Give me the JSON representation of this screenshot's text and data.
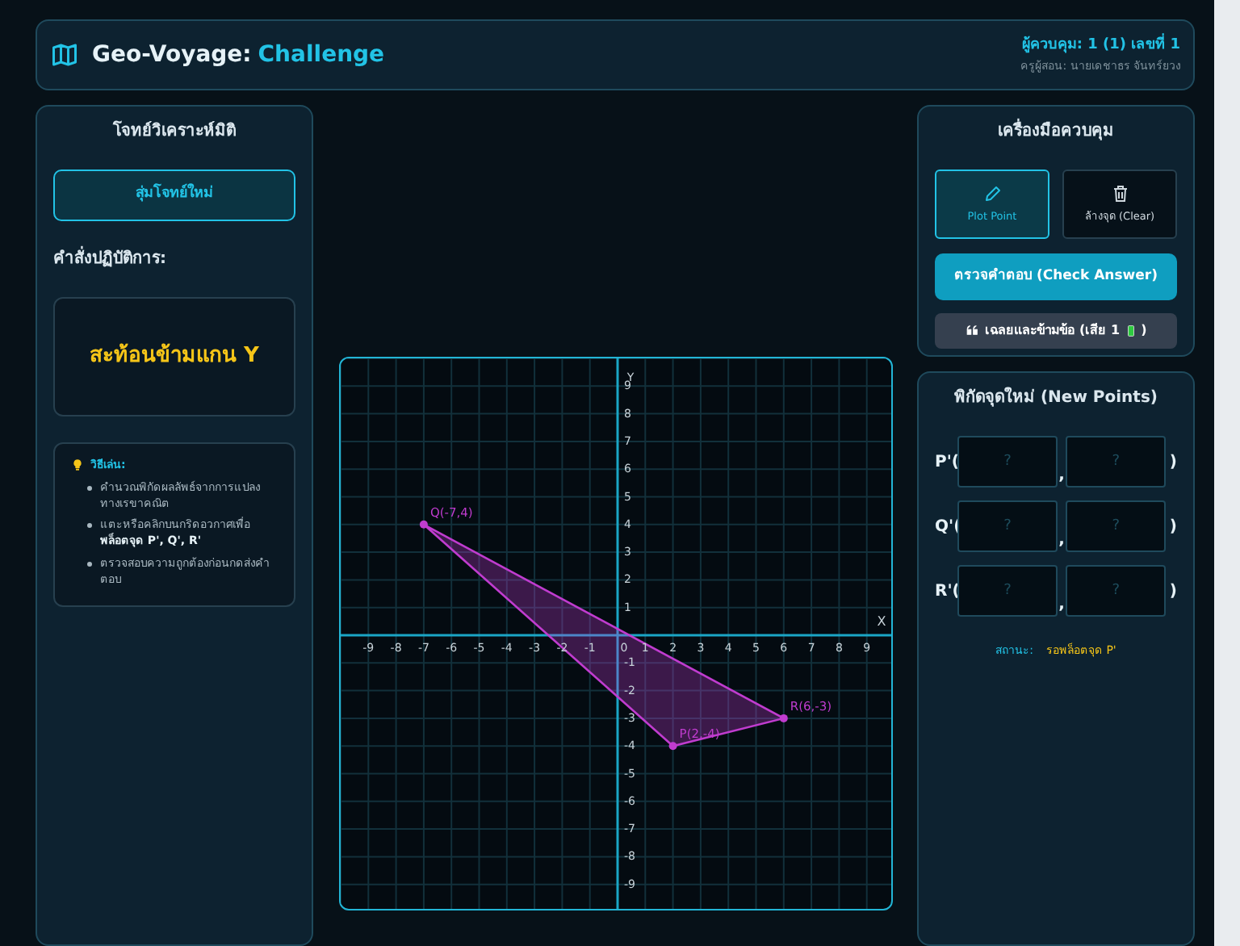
{
  "header": {
    "title": "Geo-Voyage:",
    "title_highlight": "Challenge",
    "player": "ผู้ควบคุม: 1 (1) เลขที่ 1",
    "teacher": "ครูผู้สอน: นายเดชาธร จันทร์ยวง"
  },
  "mission_panel": {
    "title": "โจทย์วิเคราะห์มิติ",
    "new_button": "สุ่มโจทย์ใหม่",
    "instruction_label": "คำสั่งปฏิบัติการ:",
    "task": "สะท้อนข้ามแกน Y",
    "tips": {
      "title": "วิธีเล่น:",
      "items": [
        "คำนวณพิกัดผลลัพธ์จากการแปลงทางเรขาคณิต",
        "แตะหรือคลิกบนกริดอวกาศเพื่อ **พล็อตจุด P', Q', R'**",
        "ตรวจสอบความถูกต้องก่อนกดส่งคำตอบ"
      ]
    }
  },
  "graph": {
    "chart_data": {
      "type": "scatter",
      "xlabel": "X",
      "ylabel": "Y",
      "grid": true,
      "xlim": [
        -10,
        10
      ],
      "ylim": [
        -10,
        10
      ],
      "xticks": [
        -9,
        -8,
        -7,
        -6,
        -5,
        -4,
        -3,
        -2,
        -1,
        0,
        1,
        2,
        3,
        4,
        5,
        6,
        7,
        8,
        9
      ],
      "yticks": [
        -9,
        -8,
        -7,
        -6,
        -5,
        -4,
        -3,
        -2,
        -1,
        1,
        2,
        3,
        4,
        5,
        6,
        7,
        8,
        9
      ],
      "x": [
        2,
        -7,
        6
      ],
      "series": [
        {
          "color": "#c03ccf",
          "values": [
            -4,
            4,
            -3
          ]
        }
      ],
      "annotations": [
        "P(2,-4)",
        "Q(-7,4)",
        "R(6,-3)"
      ]
    }
  },
  "tools_panel": {
    "title": "เครื่องมือควบคุม",
    "tools": [
      {
        "kind": "pencil",
        "label": "Plot Point",
        "selected": true
      },
      {
        "kind": "trash",
        "label": "ล้างจุด (Clear)",
        "selected": false
      }
    ],
    "check_button": "ตรวจคำตอบ (Check Answer)",
    "skip_button": {
      "text": "เฉลยและข้ามข้อ (เสีย 1",
      "close": ")"
    }
  },
  "points_panel": {
    "title": "พิกัดจุดใหม่ (New Points)",
    "rows": [
      {
        "label": "P'(",
        "separator": ",",
        "close": ")",
        "x_placeholder": "?",
        "y_placeholder": "?"
      },
      {
        "label": "Q'(",
        "separator": ",",
        "close": ")",
        "x_placeholder": "?",
        "y_placeholder": "?"
      },
      {
        "label": "R'(",
        "separator": ",",
        "close": ")",
        "x_placeholder": "?",
        "y_placeholder": "?"
      }
    ],
    "status_label": "สถานะ:",
    "status": "รอพล็อตจุด P'"
  }
}
